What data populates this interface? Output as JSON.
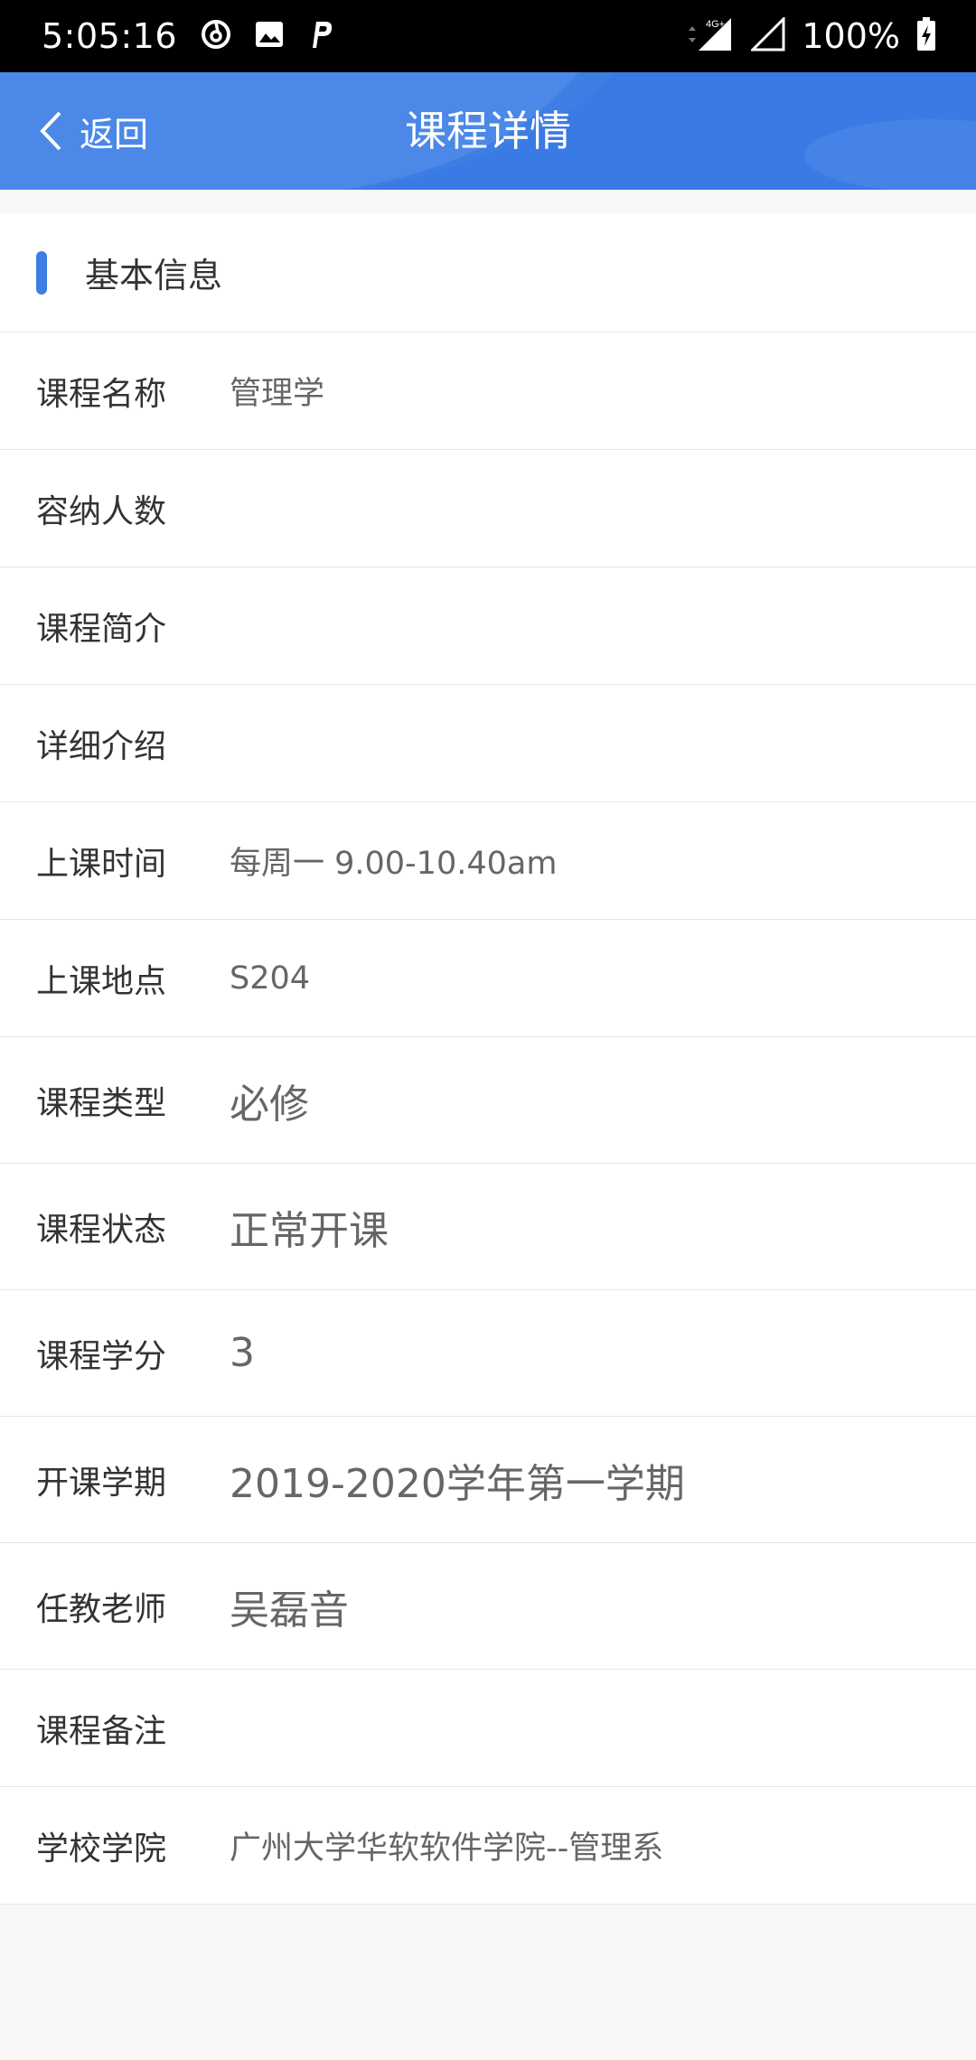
{
  "status_bar": {
    "time": "5:05:16",
    "network_badge": "4G+",
    "battery": "100%",
    "icons": [
      "netease-cloud-music-icon",
      "gallery-icon",
      "p-app-icon",
      "data-arrows-icon",
      "signal-icon",
      "signal-empty-icon",
      "battery-charging-icon"
    ]
  },
  "header": {
    "back_label": "返回",
    "title": "课程详情",
    "background": "#3d7ee3"
  },
  "section": {
    "title": "基本信息",
    "accent": "#3d7ee3"
  },
  "rows": [
    {
      "label": "课程名称",
      "value": "管理学"
    },
    {
      "label": "容纳人数",
      "value": ""
    },
    {
      "label": "课程简介",
      "value": ""
    },
    {
      "label": "详细介绍",
      "value": ""
    },
    {
      "label": "上课时间",
      "value": "每周一 9.00-10.40am"
    },
    {
      "label": "上课地点",
      "value": "S204"
    },
    {
      "label": "课程类型",
      "value": "必修"
    },
    {
      "label": "课程状态",
      "value": "正常开课"
    },
    {
      "label": "课程学分",
      "value": "3"
    },
    {
      "label": "开课学期",
      "value": "2019-2020学年第一学期"
    },
    {
      "label": "任教老师",
      "value": "吴磊音"
    },
    {
      "label": "课程备注",
      "value": ""
    },
    {
      "label": "学校学院",
      "value": "广州大学华软软件学院--管理系"
    }
  ]
}
